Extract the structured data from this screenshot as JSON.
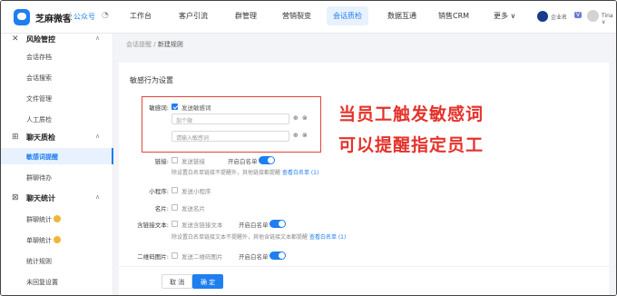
{
  "app": {
    "brand": "芝麻微客",
    "public_account": "公众号"
  },
  "nav": [
    "工作台",
    "客户引流",
    "群管理",
    "营销裂变",
    "会话质检",
    "数据互通",
    "销售CRM",
    "更多 ∨"
  ],
  "nav_active_index": 4,
  "user": {
    "enterprise": "企业名",
    "vip_tag": "V",
    "name": "Tina ∨"
  },
  "sidebar": {
    "groups": [
      {
        "label": "风险管控",
        "items": [
          "会话存档",
          "会话搜索",
          "文件管理",
          "人工质检"
        ]
      },
      {
        "label": "聊天质检",
        "items": [
          "敏感词提醒",
          "群聊待办"
        ]
      },
      {
        "label": "聊天统计",
        "items": [
          "群聊统计",
          "单聊统计",
          "统计规则",
          "未回复设置"
        ]
      }
    ],
    "active_item": "敏感词提醒"
  },
  "breadcrumb": {
    "parent": "会话提醒",
    "sep": "/",
    "current": "新建规则"
  },
  "form": {
    "section_title": "敏感行为设置",
    "sensitive": {
      "label": "敏感词:",
      "checkbox_label": "发送敏感词",
      "checked": true,
      "input1_value": "加个微",
      "input2_placeholder": "请输入敏感词"
    },
    "link": {
      "label": "链接:",
      "checkbox_label": "发送链接",
      "whitelist_label": "开启白名单",
      "hint": "除设置白名单链接不提醒外，其他链接都提醒",
      "view_link": "查看白名单 (1)"
    },
    "miniprogram": {
      "label": "小程序:",
      "checkbox_label": "发送小程序"
    },
    "card": {
      "label": "名片:",
      "checkbox_label": "发送名片"
    },
    "link_text": {
      "label": "含链接文本:",
      "checkbox_label": "发送含链接文本",
      "whitelist_label": "开启白名单",
      "hint": "除设置白名单链接文本不提醒外，其他含链接文本都提醒",
      "view_link": "查看白名单 (1)"
    },
    "qrcode": {
      "label": "二维码图片:",
      "checkbox_label": "发送二维码图片",
      "whitelist_label": "开启白名单"
    }
  },
  "overlay": {
    "line1": "当员工触发敏感词",
    "line2": "可以提醒指定员工"
  },
  "footer": {
    "cancel": "取 消",
    "confirm": "确 定"
  },
  "colors": {
    "accent": "#1f7ef0",
    "annotation": "#e5322a"
  }
}
